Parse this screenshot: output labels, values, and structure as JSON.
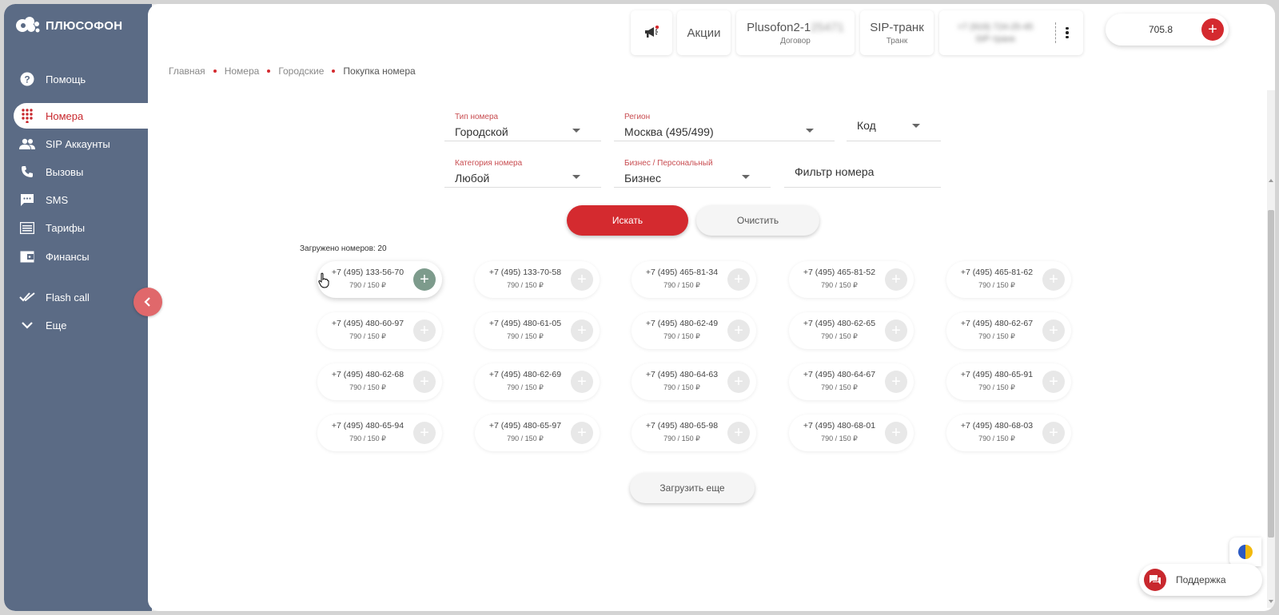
{
  "app": {
    "brand": "ПЛЮСОФОН"
  },
  "sidebar": {
    "items": [
      {
        "label": "Помощь"
      },
      {
        "label": "Номера"
      },
      {
        "label": "SIP Аккаунты"
      },
      {
        "label": "Вызовы"
      },
      {
        "label": "SMS"
      },
      {
        "label": "Тарифы"
      },
      {
        "label": "Финансы"
      },
      {
        "label": "Flash call"
      },
      {
        "label": "Еще"
      }
    ]
  },
  "topbar": {
    "promo": "Акции",
    "contract_title": "Plusofon2-1",
    "contract_hidden": "25471",
    "contract_sub": "Договор",
    "trunk_title": "SIP-транк",
    "trunk_sub": "Транк",
    "phone_hidden_1": "+7 (919) 724-25-45",
    "phone_hidden_2": "SIP-транк",
    "balance": "705.8"
  },
  "breadcrumb": [
    "Главная",
    "Номера",
    "Городские",
    "Покупка номера"
  ],
  "form": {
    "type_label": "Тип номера",
    "type_value": "Городской",
    "region_label": "Регион",
    "region_value": "Москва (495/499)",
    "code_value": "Код",
    "category_label": "Категория номера",
    "category_value": "Любой",
    "business_label": "Бизнес / Персональный",
    "business_value": "Бизнес",
    "filter_placeholder": "Фильтр номера",
    "search_button": "Искать",
    "clear_button": "Очистить"
  },
  "results": {
    "loaded_text": "Загружено номеров: 20",
    "numbers": [
      {
        "number": "+7 (495) 133-56-70",
        "price": "790 / 150 ₽"
      },
      {
        "number": "+7 (495) 133-70-58",
        "price": "790 / 150 ₽"
      },
      {
        "number": "+7 (495) 465-81-34",
        "price": "790 / 150 ₽"
      },
      {
        "number": "+7 (495) 465-81-52",
        "price": "790 / 150 ₽"
      },
      {
        "number": "+7 (495) 465-81-62",
        "price": "790 / 150 ₽"
      },
      {
        "number": "+7 (495) 480-60-97",
        "price": "790 / 150 ₽"
      },
      {
        "number": "+7 (495) 480-61-05",
        "price": "790 / 150 ₽"
      },
      {
        "number": "+7 (495) 480-62-49",
        "price": "790 / 150 ₽"
      },
      {
        "number": "+7 (495) 480-62-65",
        "price": "790 / 150 ₽"
      },
      {
        "number": "+7 (495) 480-62-67",
        "price": "790 / 150 ₽"
      },
      {
        "number": "+7 (495) 480-62-68",
        "price": "790 / 150 ₽"
      },
      {
        "number": "+7 (495) 480-62-69",
        "price": "790 / 150 ₽"
      },
      {
        "number": "+7 (495) 480-64-63",
        "price": "790 / 150 ₽"
      },
      {
        "number": "+7 (495) 480-64-67",
        "price": "790 / 150 ₽"
      },
      {
        "number": "+7 (495) 480-65-91",
        "price": "790 / 150 ₽"
      },
      {
        "number": "+7 (495) 480-65-94",
        "price": "790 / 150 ₽"
      },
      {
        "number": "+7 (495) 480-65-97",
        "price": "790 / 150 ₽"
      },
      {
        "number": "+7 (495) 480-65-98",
        "price": "790 / 150 ₽"
      },
      {
        "number": "+7 (495) 480-68-01",
        "price": "790 / 150 ₽"
      },
      {
        "number": "+7 (495) 480-68-03",
        "price": "790 / 150 ₽"
      }
    ],
    "load_more": "Загрузить еще"
  },
  "support": {
    "label": "Поддержка"
  },
  "colors": {
    "sidebar": "#5b6b85",
    "accent": "#d42a2f",
    "hover_add": "#7d9b8c"
  }
}
